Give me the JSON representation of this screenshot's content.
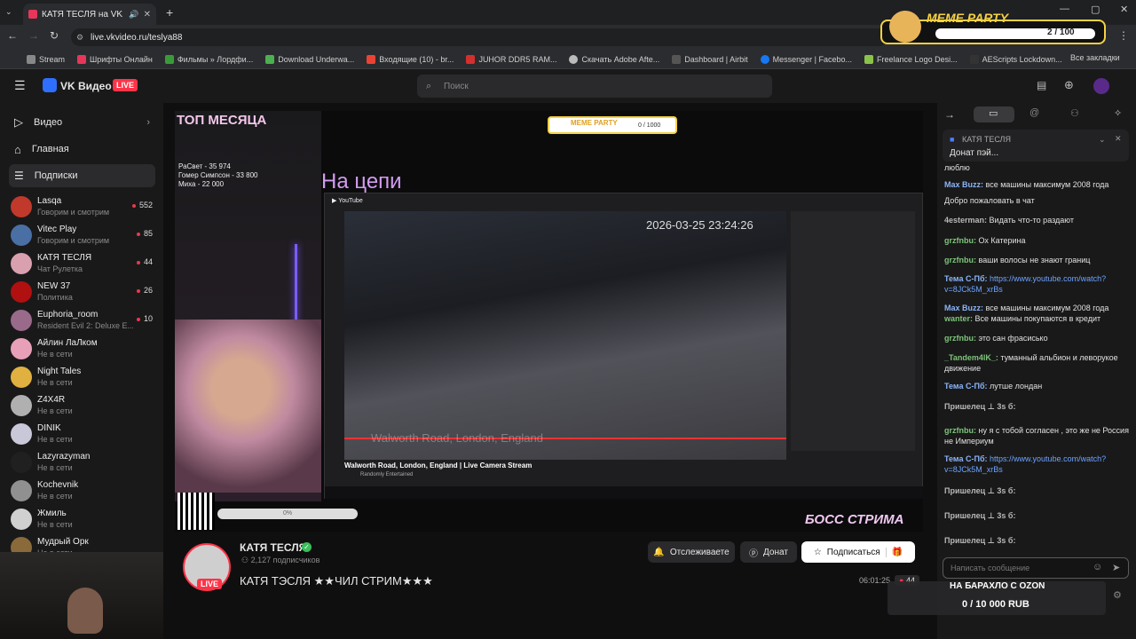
{
  "browser": {
    "tab_title": "КАТЯ ТЕСЛЯ на VK Видео |",
    "url": "live.vkvideo.ru/teslya88",
    "bookmarks": [
      "Stream",
      "Шрифты Онлайн",
      "Фильмы » Лордфи...",
      "Download Underwa...",
      "Входящие (10) - br...",
      "JUHOR DDR5 RAM...",
      "Скачать Adobe Afte...",
      "Dashboard | Airbit",
      "Messenger | Facebo...",
      "Freelance Logo Desi...",
      "AEScripts Lockdown..."
    ],
    "all_bookmarks": "Все закладки"
  },
  "overlay_top": {
    "title": "MEME PARTY",
    "progress_text": "2 / 100"
  },
  "vk": {
    "logo_text": "VK Видео",
    "live_badge": "LIVE",
    "search_placeholder": "Поиск"
  },
  "sidebar": {
    "nav": [
      {
        "label": "Видео"
      },
      {
        "label": "Главная"
      },
      {
        "label": "Подписки"
      }
    ],
    "channels": [
      {
        "name": "Lasqa",
        "sub": "Говорим и смотрим",
        "count": "552",
        "color": "#c0392b"
      },
      {
        "name": "Vitec Play",
        "sub": "Говорим и смотрим",
        "count": "85",
        "color": "#4a6fa5"
      },
      {
        "name": "КАТЯ ТЕСЛЯ",
        "sub": "Чат Рулетка",
        "count": "44",
        "color": "#d9a0b0"
      },
      {
        "name": "NEW 37",
        "sub": "Политика",
        "count": "26",
        "color": "#b01010"
      },
      {
        "name": "Euphoria_room",
        "sub": "Resident Evil 2: Deluxe E...",
        "count": "10",
        "color": "#9a6a8a"
      },
      {
        "name": "Айлин ЛаЛком",
        "sub": "Не в сети",
        "count": "",
        "color": "#e8a0b8"
      },
      {
        "name": "Night Tales",
        "sub": "Не в сети",
        "count": "",
        "color": "#e0b040"
      },
      {
        "name": "Z4X4R",
        "sub": "Не в сети",
        "count": "",
        "color": "#b0b0b0"
      },
      {
        "name": "DINIK",
        "sub": "Не в сети",
        "count": "",
        "color": "#c8c8d8"
      },
      {
        "name": "Lazyrazyman",
        "sub": "Не в сети",
        "count": "",
        "color": "#202020"
      },
      {
        "name": "Kochevnik",
        "sub": "Не в сети",
        "count": "",
        "color": "#909090"
      },
      {
        "name": "Жмиль",
        "sub": "Не в сети",
        "count": "",
        "color": "#d0d0d0"
      },
      {
        "name": "Мудрый Орк",
        "sub": "Не в сети",
        "count": "",
        "color": "#8a6a3a"
      }
    ]
  },
  "stream_overlay": {
    "top_title": "ТОП МЕСЯЦА",
    "top_list": [
      "РаСвет - 35 974",
      "Гомер Симпсон - 33 800",
      "Миха - 22 000"
    ],
    "scene_title": "На цепи",
    "timestamp": "2026-03-25 23:24:26",
    "inner_meme_title": "MEME PARTY",
    "inner_meme_progress": "0 / 1000",
    "video_title": "Walworth Road, London, England | Live Camera Stream",
    "video_channel": "Randomly Entertained",
    "boss_label": "БОСС СТРИМА",
    "donation_progress": "0%",
    "watermark": "Walworth Road, London, England"
  },
  "streamer": {
    "name": "КАТЯ ТЕСЛЯ",
    "subscribers": "2,127 подписчиков",
    "live_badge": "LIVE",
    "stream_title": "КАТЯ ТЭСЛЯ ★★ЧИЛ СТРИМ★★★",
    "duration": "06:01:25",
    "viewers": "44",
    "btn_following": "Отслеживаете",
    "btn_donate": "Донат",
    "btn_subscribe": "Подписаться"
  },
  "chat": {
    "pinned_user": "КАТЯ ТЕСЛЯ",
    "pinned_text": "Донат пэй...",
    "message_placeholder": "Написать сообщение",
    "messages": [
      {
        "user": "",
        "text": "люблю"
      },
      {
        "user": "Max Buzz:",
        "text": "все машины максимум 2008 года"
      },
      {
        "user": "",
        "text": "Добро пожаловать в чат"
      },
      {
        "user": "4esterman:",
        "text": "Видать что-то раздают"
      },
      {
        "user": "grzfnbu:",
        "text": "Ох Катерина"
      },
      {
        "user": "grzfnbu:",
        "text": "ваши волосы не знают границ"
      },
      {
        "user": "Тема С-Пб:",
        "text": "https://www.youtube.com/watch?v=8JCk5M_xrBs"
      },
      {
        "user": "Max Buzz:",
        "text": "все машины максимум 2008 года"
      },
      {
        "user": "wanter:",
        "text": "Все машины покупаются в кредит"
      },
      {
        "user": "grzfnbu:",
        "text": "это сан фрасисько"
      },
      {
        "user": "_Tandem4lK_:",
        "text": "туманный альбион и леворукое движение"
      },
      {
        "user": "Тема С-Пб:",
        "text": "лутше лондан"
      },
      {
        "user": "Пришелец ⊥ 3s б:",
        "text": ""
      },
      {
        "user": "grzfnbu:",
        "text": "ну я с тобой согласен , это же не Россия не Империум"
      },
      {
        "user": "Тема С-Пб:",
        "text": "https://www.youtube.com/watch?v=8JCk5M_xrBs"
      },
      {
        "user": "Пришелец ⊥ 3s б:",
        "text": ""
      },
      {
        "user": "Пришелец ⊥ 3s б:",
        "text": ""
      },
      {
        "user": "Пришелец ⊥ 3s б:",
        "text": ""
      }
    ]
  },
  "bottom_overlay": {
    "title": "НА БАРАХЛО С OZON",
    "amount": "0 / 10 000 RUB"
  }
}
